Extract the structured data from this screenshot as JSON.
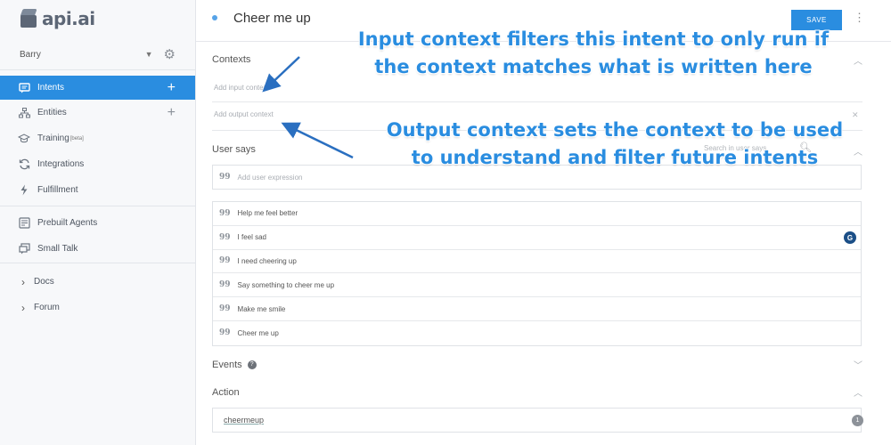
{
  "app": {
    "brand": "api.ai",
    "accent": "#2a8de0"
  },
  "agent": {
    "name": "Barry"
  },
  "sidebar": {
    "items": [
      {
        "label": "Intents",
        "icon": "chat-icon",
        "plus": true,
        "active": true
      },
      {
        "label": "Entities",
        "icon": "sitemap-icon",
        "plus": true
      },
      {
        "label": "Training",
        "badge": "[beta]",
        "icon": "graduation-cap-icon"
      },
      {
        "label": "Integrations",
        "icon": "sync-icon"
      },
      {
        "label": "Fulfillment",
        "icon": "lightning-icon"
      }
    ],
    "items2": [
      {
        "label": "Prebuilt Agents",
        "icon": "agent-icon"
      },
      {
        "label": "Small Talk",
        "icon": "speech-icon"
      }
    ],
    "items3": [
      {
        "label": "Docs",
        "icon": "chevron-right-icon"
      },
      {
        "label": "Forum",
        "icon": "chevron-right-icon"
      }
    ]
  },
  "header": {
    "title": "Cheer me up",
    "save_label": "SAVE"
  },
  "contexts": {
    "label": "Contexts",
    "input_placeholder": "Add input context",
    "output_placeholder": "Add output context"
  },
  "user_says": {
    "label": "User says",
    "search_placeholder": "Search in user says",
    "add_placeholder": "Add user expression",
    "phrases": [
      "Help me feel better",
      "I feel sad",
      "I need cheering up",
      "Say something to cheer me up",
      "Make me smile",
      "Cheer me up"
    ]
  },
  "events": {
    "label": "Events"
  },
  "action": {
    "label": "Action",
    "value": "cheermeup",
    "badge": "1"
  },
  "annotations": {
    "input_line1": "Input context filters this intent to only run if",
    "input_line2": "the context matches what is written here",
    "output_line1": "Output context sets the context to be used",
    "output_line2": "to understand and filter future intents"
  }
}
